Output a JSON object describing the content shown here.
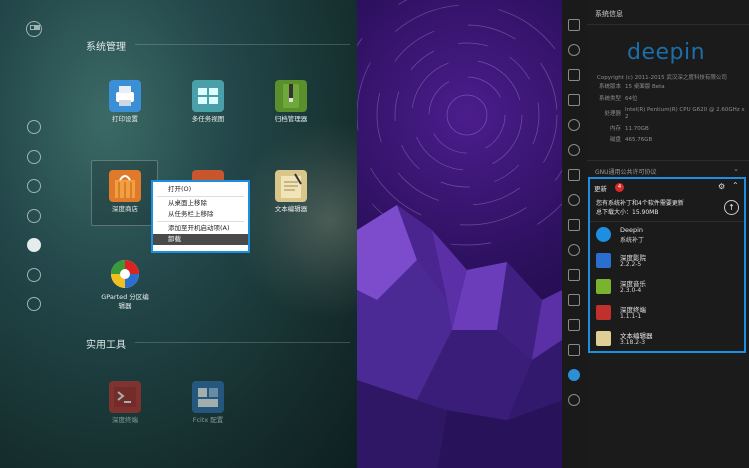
{
  "launcher": {
    "sections": [
      {
        "title": "系统管理"
      },
      {
        "title": "实用工具"
      }
    ],
    "apps": [
      {
        "label": "打印设置",
        "icon": "printer-icon",
        "color": "#3b8fd6"
      },
      {
        "label": "多任务视图",
        "icon": "multitask-icon",
        "color": "#4aa0a8"
      },
      {
        "label": "归档管理器",
        "icon": "archive-icon",
        "color": "#5a8f2c"
      },
      {
        "label": "深度商店",
        "icon": "store-icon",
        "color": "#e07a2a"
      },
      {
        "label": "文本编辑器",
        "icon": "text-editor-icon",
        "color": "#d9c68a"
      },
      {
        "label": "GParted 分区编\n辑器",
        "icon": "gparted-icon",
        "color": "#c92a2a"
      },
      {
        "label": "深度终端",
        "icon": "terminal-icon",
        "color": "#c0302c"
      },
      {
        "label": "Fcitx 配置",
        "icon": "fcitx-icon",
        "color": "#2f6fb0"
      }
    ],
    "context_menu": {
      "items": [
        "打开(O)",
        "从桌面上移除",
        "从任务栏上移除",
        "添加至开机启动项(A)",
        "卸载"
      ]
    }
  },
  "panel": {
    "title": "系统信息",
    "logo": "deepin",
    "copyright": "Copyright (c) 2011-2015 武汉深之度科技有限公司",
    "info": [
      {
        "k": "系统版本",
        "v": "15 桌面版 Beta"
      },
      {
        "k": "系统类型",
        "v": "64位"
      },
      {
        "k": "处理器",
        "v": "Intel(R) Pentium(R) CPU G620 @ 2.60GHz x 2"
      },
      {
        "k": "内存",
        "v": "11.70GB"
      },
      {
        "k": "磁盘",
        "v": "465.76GB"
      }
    ],
    "license": "GNU通用公共许可协议",
    "update": {
      "title": "更新",
      "badge": "4",
      "message_line1": "您有系统补丁和4个软件需要更新",
      "message_line2": "总下载大小：15.90MB",
      "packages": [
        {
          "name": "Deepin",
          "version": "系统补丁",
          "color": "#1d8fe0"
        },
        {
          "name": "深度影院",
          "version": "2.2.2-5",
          "color": "#2a6fd0"
        },
        {
          "name": "深度音乐",
          "version": "2.3.0-4",
          "color": "#7ab32e"
        },
        {
          "name": "深度终端",
          "version": "1.1.1-1",
          "color": "#c0302c"
        },
        {
          "name": "文本编辑器",
          "version": "3.18.2-3",
          "color": "#e0cf95"
        }
      ]
    }
  },
  "accent_color": "#1d8fe0"
}
